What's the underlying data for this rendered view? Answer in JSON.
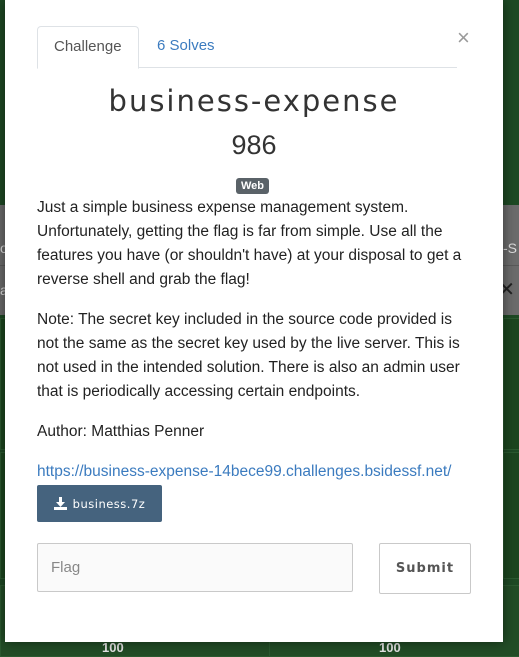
{
  "modal": {
    "close_glyph": "×",
    "tabs": [
      {
        "label": "Challenge",
        "active": true
      },
      {
        "label": "6 Solves",
        "active": false
      }
    ],
    "title": "business-expense",
    "points": "986",
    "category_tag": "Web",
    "description": [
      "Just a simple business expense management system. Unfortunately, getting the flag is far from simple. Use all the features you have (or shouldn't have) at your disposal to get a reverse shell and grab the flag!",
      "Note: The secret key included in the source code provided is not the same as the secret key used by the live server. This is not used in the intended solution. There is also an admin user that is periodically accessing certain endpoints.",
      "Author: Matthias Penner"
    ],
    "link": "https://business-expense-14bece99.challenges.bsidessf.net/",
    "download": {
      "label": "business.7z",
      "icon": "download-icon"
    },
    "flag_input": {
      "placeholder": "Flag",
      "value": ""
    },
    "submit_label": "Submit"
  },
  "background": {
    "edge_text_left": "o",
    "edge_text_left2": "a",
    "edge_text_right": "n-S",
    "close_glyph": "✕",
    "card_scores": [
      "100",
      "100"
    ]
  },
  "colors": {
    "page_background": "#1e4a24",
    "link": "#3b7bbf",
    "download_button": "#45637e",
    "tag": "#5a6268"
  }
}
